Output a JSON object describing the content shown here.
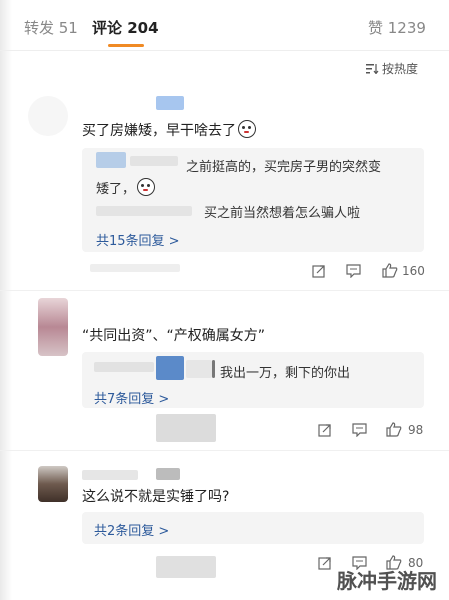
{
  "tabs": {
    "repost": "转发 51",
    "comments": "评论 204",
    "likes": "赞 1239"
  },
  "sort_label": "按热度",
  "comments": [
    {
      "text": "买了房嫌矮，早干啥去了",
      "replies": [
        "之前挺高的，买完房子男的突然变",
        "矮了，",
        "买之前当然想着怎么骗人啦"
      ],
      "more_replies": "共15条回复 >",
      "like_count": "160"
    },
    {
      "text": "“共同出资”、“产权确属女方”",
      "replies": [
        "我出一万，剩下的你出"
      ],
      "more_replies": "共7条回复 >",
      "like_count": "98"
    },
    {
      "text": "这么说不就是实锤了吗?",
      "more_replies": "共2条回复 >",
      "like_count": "80"
    }
  ],
  "watermark": "脉冲手游网",
  "colors": {
    "accent": "#f08a24",
    "link": "#2d5a9b",
    "reply_bg": "#f4f4f4"
  }
}
